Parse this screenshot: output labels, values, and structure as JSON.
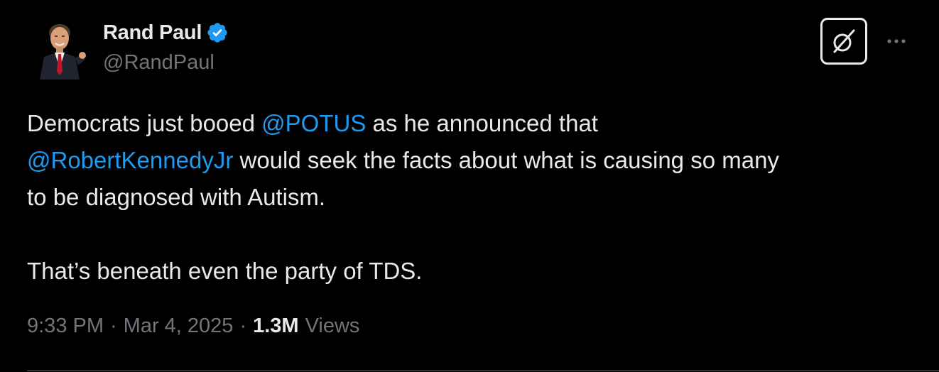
{
  "author": {
    "display_name": "Rand Paul",
    "handle": "@RandPaul",
    "verified": true,
    "verified_color": "#1d9bf0"
  },
  "actions": {
    "grok_icon": "grok-icon",
    "more_icon": "more-horizontal-icon"
  },
  "tweet": {
    "line1_pre": "Democrats just booed ",
    "mention1": "@POTUS",
    "line1_post": " as he announced that",
    "mention2": "@RobertKennedyJr",
    "line2_post": " would seek the facts about what is causing so many",
    "line3": "to be diagnosed with Autism.",
    "line4": "That’s beneath even the party of TDS."
  },
  "meta": {
    "time": "9:33 PM",
    "separator": "·",
    "date": "Mar 4, 2025",
    "views_count": "1.3M",
    "views_label": "Views"
  },
  "colors": {
    "background": "#000000",
    "text": "#e7e9ea",
    "muted": "#71767b",
    "link": "#1d9bf0"
  }
}
